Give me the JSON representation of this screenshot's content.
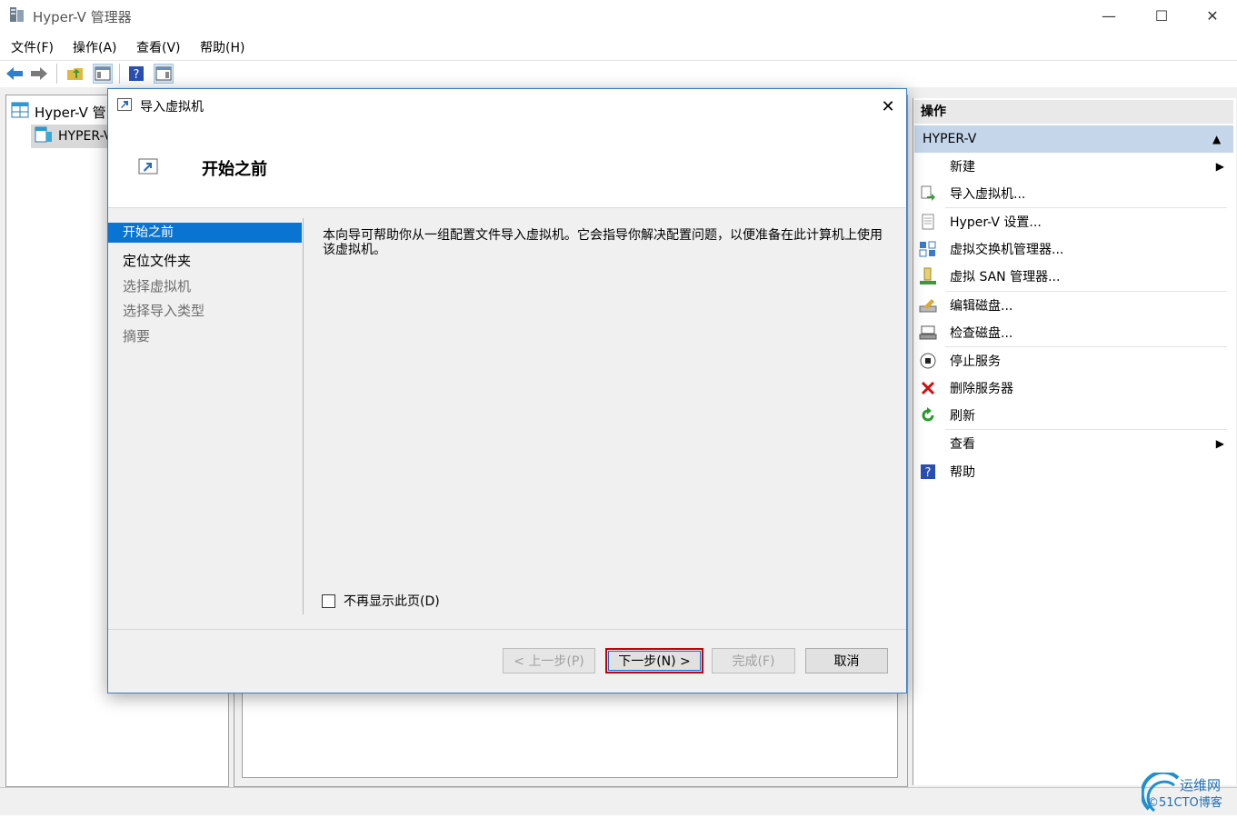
{
  "window": {
    "title": "Hyper-V 管理器",
    "minimize_glyph": "—",
    "maximize_glyph": "☐",
    "close_glyph": "✕"
  },
  "menu": {
    "file": "文件(F)",
    "action": "操作(A)",
    "view": "查看(V)",
    "help": "帮助(H)"
  },
  "tree": {
    "root": "Hyper-V 管",
    "child": "HYPER-V"
  },
  "actions": {
    "header": "操作",
    "group": "HYPER-V",
    "group_arrow": "▲",
    "items": [
      {
        "label": "新建",
        "icon": "none",
        "arrow": "▶"
      },
      {
        "label": "导入虚拟机...",
        "icon": "import-icon"
      },
      {
        "label": "Hyper-V 设置...",
        "icon": "settings-icon"
      },
      {
        "label": "虚拟交换机管理器...",
        "icon": "switch-icon"
      },
      {
        "label": "虚拟 SAN 管理器...",
        "icon": "san-icon"
      },
      {
        "label": "编辑磁盘...",
        "icon": "edit-disk-icon"
      },
      {
        "label": "检查磁盘...",
        "icon": "inspect-disk-icon"
      },
      {
        "label": "停止服务",
        "icon": "stop-icon"
      },
      {
        "label": "删除服务器",
        "icon": "delete-icon"
      },
      {
        "label": "刷新",
        "icon": "refresh-icon"
      },
      {
        "label": "查看",
        "icon": "none",
        "arrow": "▶"
      },
      {
        "label": "帮助",
        "icon": "help-icon"
      }
    ]
  },
  "dialog": {
    "title": "导入虚拟机",
    "close_glyph": "✕",
    "heading": "开始之前",
    "steps": [
      "开始之前",
      "定位文件夹",
      "选择虚拟机",
      "选择导入类型",
      "摘要"
    ],
    "description": "本向导可帮助你从一组配置文件导入虚拟机。它会指导你解决配置问题，以便准备在此计算机上使用该虚拟机。",
    "dont_show": "不再显示此页(D)",
    "buttons": {
      "prev": "< 上一步(P)",
      "next": "下一步(N) >",
      "finish": "完成(F)",
      "cancel": "取消"
    }
  },
  "watermark": {
    "line1": "运维网",
    "line2": "©51CTO博客"
  },
  "colors": {
    "selection_blue": "#0a74d2",
    "group_header": "#c5d6ea",
    "highlight_red": "#cc0000"
  }
}
